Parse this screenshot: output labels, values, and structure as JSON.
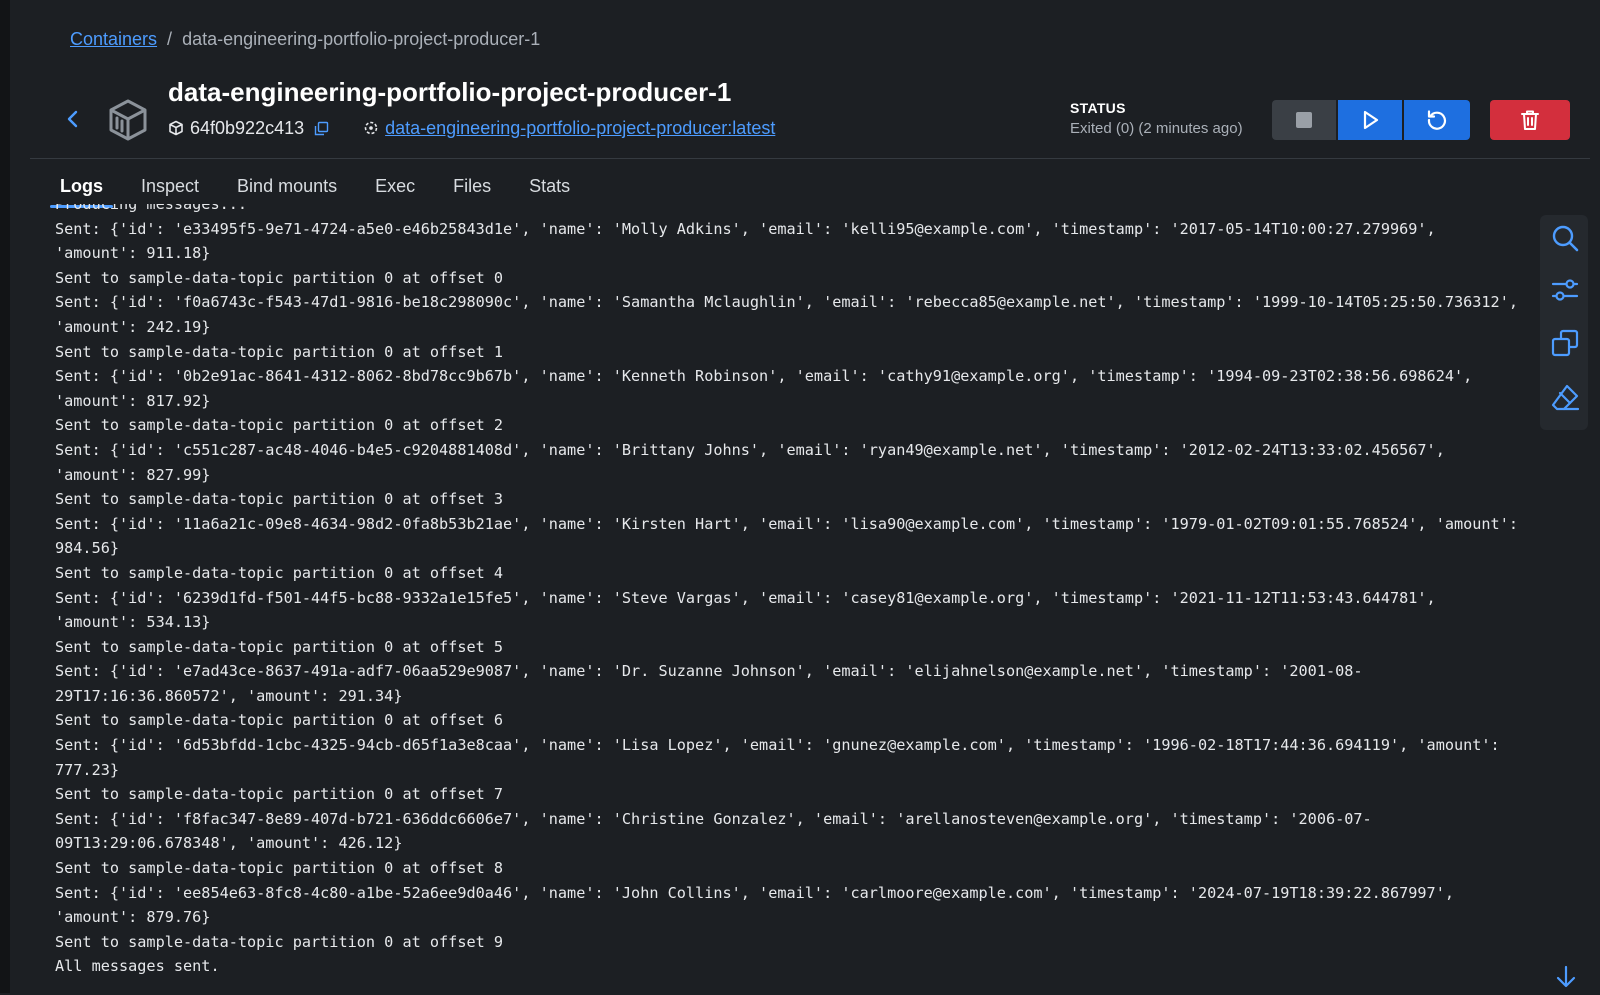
{
  "breadcrumb": {
    "root": "Containers",
    "separator": "/",
    "current": "data-engineering-portfolio-project-producer-1"
  },
  "header": {
    "title": "data-engineering-portfolio-project-producer-1",
    "container_id": "64f0b922c413",
    "image_link": "data-engineering-portfolio-project-producer:latest",
    "icons": [
      "back-icon",
      "container-icon",
      "cube-icon",
      "copy-icon",
      "image-icon"
    ]
  },
  "status": {
    "label": "STATUS",
    "value": "Exited (0) (2 minutes ago)"
  },
  "actions": {
    "icons": [
      "stop-icon",
      "play-icon",
      "restart-icon",
      "trash-icon"
    ],
    "colors": {
      "primary": "#1e6fe0",
      "danger": "#d32f3d",
      "neutral": "#3a3f45"
    }
  },
  "tabs": [
    {
      "label": "Logs",
      "active": true
    },
    {
      "label": "Inspect",
      "active": false
    },
    {
      "label": "Bind mounts",
      "active": false
    },
    {
      "label": "Exec",
      "active": false
    },
    {
      "label": "Files",
      "active": false
    },
    {
      "label": "Stats",
      "active": false
    }
  ],
  "logs": [
    "Producing messages...",
    "Sent: {'id': 'e33495f5-9e71-4724-a5e0-e46b25843d1e', 'name': 'Molly Adkins', 'email': 'kelli95@example.com', 'timestamp': '2017-05-14T10:00:27.279969',",
    "'amount': 911.18}",
    "Sent to sample-data-topic partition 0 at offset 0",
    "Sent: {'id': 'f0a6743c-f543-47d1-9816-be18c298090c', 'name': 'Samantha Mclaughlin', 'email': 'rebecca85@example.net', 'timestamp': '1999-10-14T05:25:50.736312',",
    "'amount': 242.19}",
    "Sent to sample-data-topic partition 0 at offset 1",
    "Sent: {'id': '0b2e91ac-8641-4312-8062-8bd78cc9b67b', 'name': 'Kenneth Robinson', 'email': 'cathy91@example.org', 'timestamp': '1994-09-23T02:38:56.698624',",
    "'amount': 817.92}",
    "Sent to sample-data-topic partition 0 at offset 2",
    "Sent: {'id': 'c551c287-ac48-4046-b4e5-c9204881408d', 'name': 'Brittany Johns', 'email': 'ryan49@example.net', 'timestamp': '2012-02-24T13:33:02.456567',",
    "'amount': 827.99}",
    "Sent to sample-data-topic partition 0 at offset 3",
    "Sent: {'id': '11a6a21c-09e8-4634-98d2-0fa8b53b21ae', 'name': 'Kirsten Hart', 'email': 'lisa90@example.com', 'timestamp': '1979-01-02T09:01:55.768524', 'amount':",
    "984.56}",
    "Sent to sample-data-topic partition 0 at offset 4",
    "Sent: {'id': '6239d1fd-f501-44f5-bc88-9332a1e15fe5', 'name': 'Steve Vargas', 'email': 'casey81@example.org', 'timestamp': '2021-11-12T11:53:43.644781',",
    "'amount': 534.13}",
    "Sent to sample-data-topic partition 0 at offset 5",
    "Sent: {'id': 'e7ad43ce-8637-491a-adf7-06aa529e9087', 'name': 'Dr. Suzanne Johnson', 'email': 'elijahnelson@example.net', 'timestamp': '2001-08-",
    "29T17:16:36.860572', 'amount': 291.34}",
    "Sent to sample-data-topic partition 0 at offset 6",
    "Sent: {'id': '6d53bfdd-1cbc-4325-94cb-d65f1a3e8caa', 'name': 'Lisa Lopez', 'email': 'gnunez@example.com', 'timestamp': '1996-02-18T17:44:36.694119', 'amount':",
    "777.23}",
    "Sent to sample-data-topic partition 0 at offset 7",
    "Sent: {'id': 'f8fac347-8e89-407d-b721-636ddc6606e7', 'name': 'Christine Gonzalez', 'email': 'arellanosteven@example.org', 'timestamp': '2006-07-",
    "09T13:29:06.678348', 'amount': 426.12}",
    "Sent to sample-data-topic partition 0 at offset 8",
    "Sent: {'id': 'ee854e63-8fc8-4c80-a1be-52a6ee9d0a46', 'name': 'John Collins', 'email': 'carlmoore@example.com', 'timestamp': '2024-07-19T18:39:22.867997',",
    "'amount': 879.76}",
    "Sent to sample-data-topic partition 0 at offset 9",
    "All messages sent."
  ],
  "side_toolbar": {
    "icons": [
      "search-icon",
      "filter-icon",
      "copy-icon",
      "eraser-icon"
    ]
  },
  "scroll": {
    "icon": "arrow-down-icon"
  }
}
